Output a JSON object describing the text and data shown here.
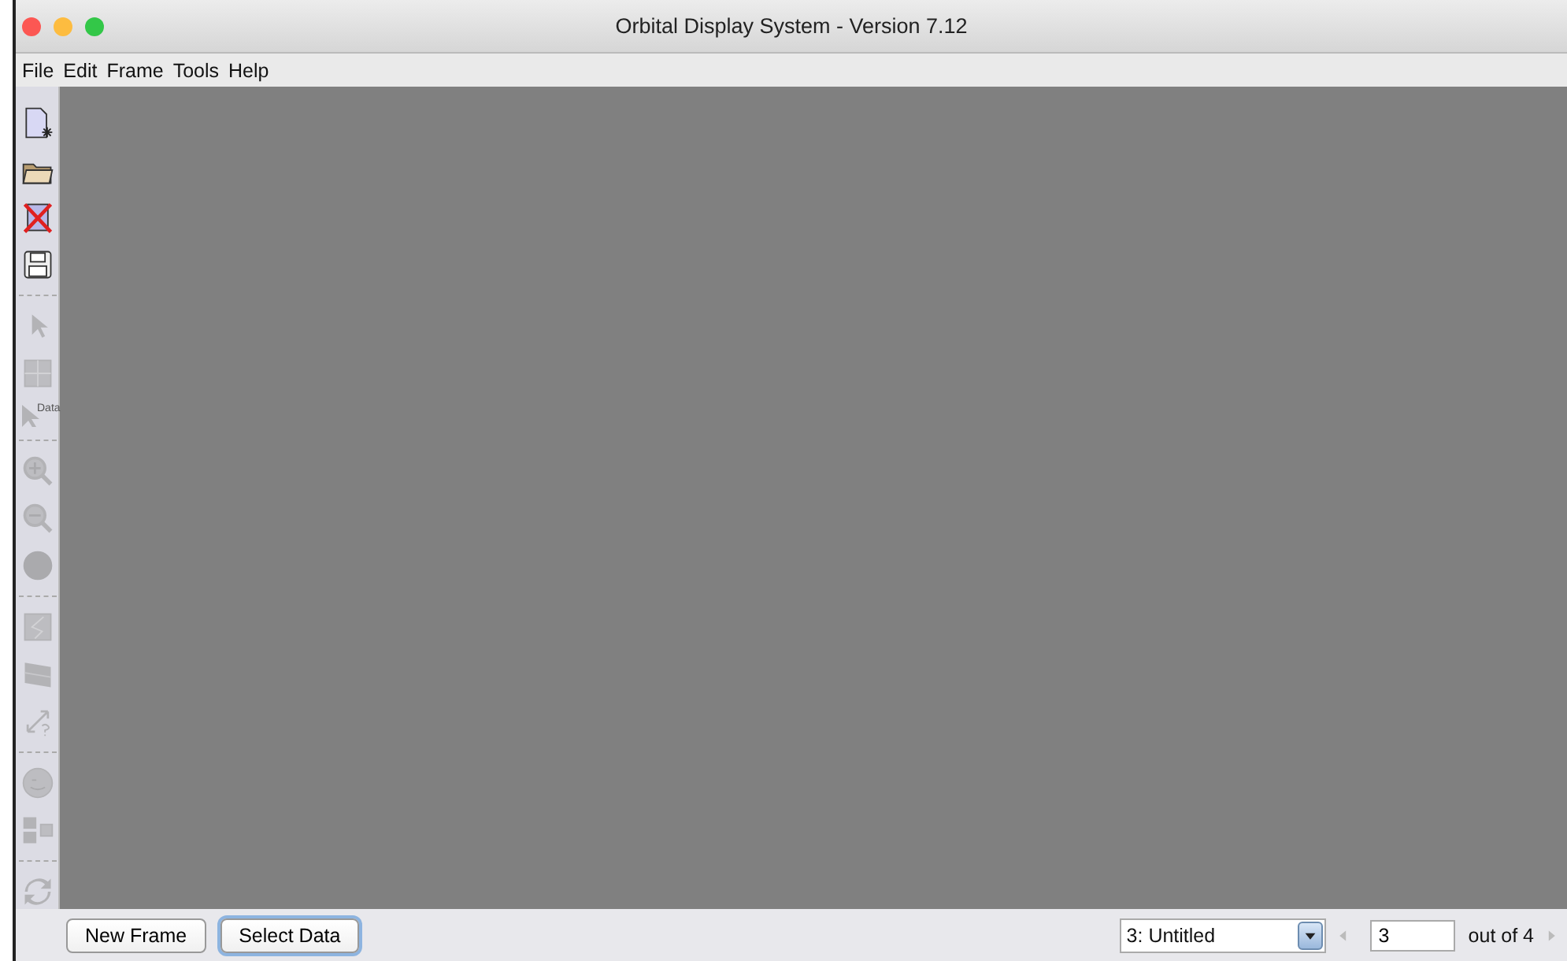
{
  "window": {
    "title": "Orbital Display System - Version 7.12"
  },
  "menu": [
    "File",
    "Edit",
    "Frame",
    "Tools",
    "Help"
  ],
  "toolbar": {
    "groups": [
      [
        {
          "kind": "new-file",
          "disabled": false
        },
        {
          "kind": "folder",
          "disabled": false
        },
        {
          "kind": "delete",
          "disabled": false
        },
        {
          "kind": "save",
          "disabled": false
        }
      ],
      [
        {
          "kind": "pointer",
          "disabled": true
        },
        {
          "kind": "grid",
          "disabled": true
        },
        {
          "kind": "data-pointer",
          "label": "Data",
          "disabled": true
        }
      ],
      [
        {
          "kind": "zoom-in",
          "disabled": true
        },
        {
          "kind": "zoom-out",
          "disabled": true
        },
        {
          "kind": "globe",
          "disabled": true
        }
      ],
      [
        {
          "kind": "map",
          "disabled": true
        },
        {
          "kind": "flat-map",
          "disabled": true
        },
        {
          "kind": "resize",
          "disabled": true
        }
      ],
      [
        {
          "kind": "face",
          "disabled": true
        },
        {
          "kind": "layout",
          "disabled": true
        }
      ],
      [
        {
          "kind": "refresh",
          "disabled": true
        }
      ]
    ]
  },
  "bottom_bar": {
    "buttons": [
      {
        "label": "New Frame",
        "focused": false
      },
      {
        "label": "Select Data",
        "focused": true
      }
    ],
    "frame_select": {
      "value": "3: Untitled"
    },
    "prev_disabled": true,
    "frame_field": {
      "value": "3"
    },
    "count": "out of 4",
    "next_disabled": true
  }
}
